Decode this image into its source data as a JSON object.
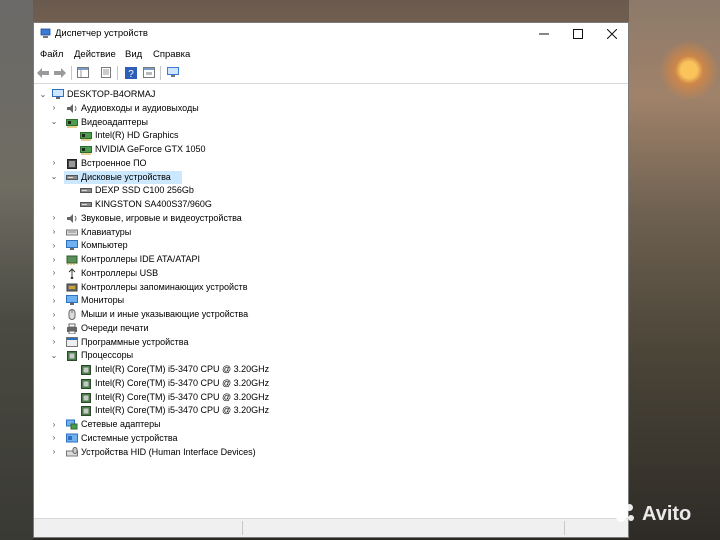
{
  "window": {
    "title": "Диспетчер устройств"
  },
  "menu": [
    "Файл",
    "Действие",
    "Вид",
    "Справка"
  ],
  "tree": {
    "root": "DESKTOP-B4ORMAJ",
    "items": [
      {
        "label": "Аудиовходы и аудиовыходы",
        "icon": "speaker-icon",
        "state": "collapsed"
      },
      {
        "label": "Видеоадаптеры",
        "icon": "display-adapter-icon",
        "state": "expanded"
      },
      {
        "label": "Intel(R) HD Graphics",
        "icon": "display-adapter-icon",
        "child": true
      },
      {
        "label": "NVIDIA GeForce GTX 1050",
        "icon": "display-adapter-icon",
        "child": true
      },
      {
        "label": "Встроенное ПО",
        "icon": "firmware-icon",
        "state": "collapsed"
      },
      {
        "label": "Дисковые устройства",
        "icon": "disk-drive-icon",
        "state": "expanded",
        "selected": true
      },
      {
        "label": "DEXP SSD C100 256Gb",
        "icon": "disk-drive-icon",
        "child": true
      },
      {
        "label": "KINGSTON SA400S37/960G",
        "icon": "disk-drive-icon",
        "child": true
      },
      {
        "label": "Звуковые, игровые и видеоустройства",
        "icon": "speaker-icon",
        "state": "collapsed"
      },
      {
        "label": "Клавиатуры",
        "icon": "keyboard-icon",
        "state": "collapsed"
      },
      {
        "label": "Компьютер",
        "icon": "monitor-icon",
        "state": "collapsed"
      },
      {
        "label": "Контроллеры IDE ATA/ATAPI",
        "icon": "ide-controller-icon",
        "state": "collapsed"
      },
      {
        "label": "Контроллеры USB",
        "icon": "usb-icon",
        "state": "collapsed"
      },
      {
        "label": "Контроллеры запоминающих устройств",
        "icon": "storage-controller-icon",
        "state": "collapsed"
      },
      {
        "label": "Мониторы",
        "icon": "monitor-icon",
        "state": "collapsed"
      },
      {
        "label": "Мыши и иные указывающие устройства",
        "icon": "mouse-icon",
        "state": "collapsed"
      },
      {
        "label": "Очереди печати",
        "icon": "printer-icon",
        "state": "collapsed"
      },
      {
        "label": "Программные устройства",
        "icon": "software-device-icon",
        "state": "collapsed"
      },
      {
        "label": "Процессоры",
        "icon": "processor-icon",
        "state": "expanded"
      },
      {
        "label": "Intel(R) Core(TM) i5-3470 CPU @ 3.20GHz",
        "icon": "processor-icon",
        "child": true
      },
      {
        "label": "Intel(R) Core(TM) i5-3470 CPU @ 3.20GHz",
        "icon": "processor-icon",
        "child": true
      },
      {
        "label": "Intel(R) Core(TM) i5-3470 CPU @ 3.20GHz",
        "icon": "processor-icon",
        "child": true
      },
      {
        "label": "Intel(R) Core(TM) i5-3470 CPU @ 3.20GHz",
        "icon": "processor-icon",
        "child": true
      },
      {
        "label": "Сетевые адаптеры",
        "icon": "network-adapter-icon",
        "state": "collapsed"
      },
      {
        "label": "Системные устройства",
        "icon": "system-device-icon",
        "state": "collapsed"
      },
      {
        "label": "Устройства HID (Human Interface Devices)",
        "icon": "hid-icon",
        "state": "collapsed"
      }
    ]
  },
  "watermark": "Avito",
  "colors": {
    "selection": "#cce8ff",
    "accent": "#2e6fbf"
  }
}
